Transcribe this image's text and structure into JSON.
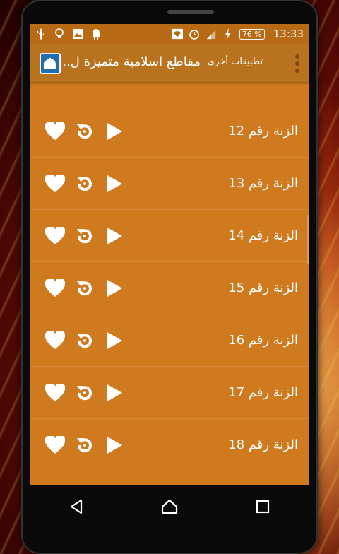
{
  "statusbar": {
    "battery": "76 %",
    "time": "13:33",
    "icons": [
      "usb-icon",
      "bulb-icon",
      "image-icon",
      "android-icon",
      "wifi-icon",
      "alarm-icon",
      "signal-icon",
      "charging-icon"
    ]
  },
  "appbar": {
    "title": "مقاطع اسلامية متميزة ل..",
    "other_apps": "تطبيقات أخرى",
    "menu_icon": "overflow-menu-icon"
  },
  "list": {
    "items": [
      {
        "label": "الزنة رقم 12"
      },
      {
        "label": "الزنة رقم 13"
      },
      {
        "label": "الزنة رقم 14"
      },
      {
        "label": "الزنة رقم 15"
      },
      {
        "label": "الزنة رقم 16"
      },
      {
        "label": "الزنة رقم 17"
      },
      {
        "label": "الزنة رقم 18"
      }
    ],
    "row_icons": [
      "heart-icon",
      "replay-icon",
      "play-icon"
    ]
  },
  "navbar": {
    "icons": [
      "back-icon",
      "home-icon",
      "recents-icon"
    ]
  },
  "colors": {
    "screen_bg": "#cf7a1e",
    "appbar_bg": "#b9731f",
    "statusbar_bg": "#b96a14"
  }
}
